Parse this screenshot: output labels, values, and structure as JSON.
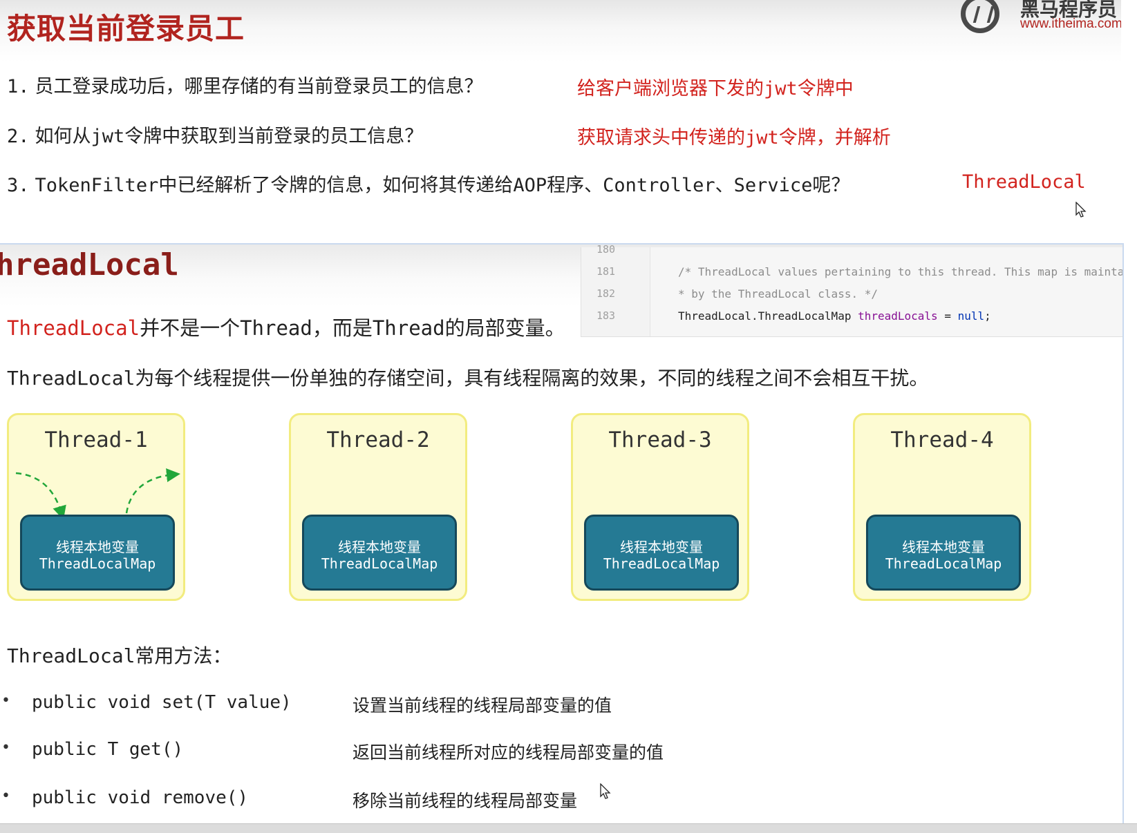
{
  "top": {
    "title": "获取当前登录员工",
    "logo": {
      "brand": "黑马程序员",
      "url": "www.itheima.com"
    },
    "questions": [
      {
        "num": "1.",
        "text": "员工登录成功后，哪里存储的有当前登录员工的信息？",
        "answer": "给客户端浏览器下发的jwt令牌中"
      },
      {
        "num": "2.",
        "text": "如何从jwt令牌中获取到当前登录的员工信息？",
        "answer": "获取请求头中传递的jwt令牌，并解析"
      },
      {
        "num": "3.",
        "text": "TokenFilter中已经解析了令牌的信息，如何将其传递给AOP程序、Controller、Service呢？",
        "answer": "ThreadLocal"
      }
    ]
  },
  "bottom": {
    "title": "hreadLocal",
    "code": {
      "lines": [
        {
          "num": "180",
          "text": ""
        },
        {
          "num": "181",
          "text": "/* ThreadLocal values pertaining to this thread. This map is maintai"
        },
        {
          "num": "182",
          "text": " * by the ThreadLocal class. */"
        },
        {
          "num": "183",
          "type_text": "ThreadLocal.ThreadLocalMap ",
          "var_text": "threadLocals",
          "eq_text": " = ",
          "kw_text": "null",
          "end_text": ";"
        }
      ]
    },
    "intro": {
      "red": "ThreadLocal",
      "rest": "并不是一个Thread，而是Thread的局部变量。"
    },
    "description": "ThreadLocal为每个线程提供一份单独的存储空间，具有线程隔离的效果，不同的线程之间不会相互干扰。",
    "threads": [
      {
        "name": "Thread-1",
        "map_cn": "线程本地变量",
        "map_en": "ThreadLocalMap"
      },
      {
        "name": "Thread-2",
        "map_cn": "线程本地变量",
        "map_en": "ThreadLocalMap"
      },
      {
        "name": "Thread-3",
        "map_cn": "线程本地变量",
        "map_en": "ThreadLocalMap"
      },
      {
        "name": "Thread-4",
        "map_cn": "线程本地变量",
        "map_en": "ThreadLocalMap"
      }
    ],
    "methods_title": "ThreadLocal常用方法：",
    "methods": [
      {
        "bullet": "•",
        "signature": "public void set(T value)",
        "desc": "设置当前线程的线程局部变量的值"
      },
      {
        "bullet": "•",
        "signature": "public T get()",
        "desc": "返回当前线程所对应的线程局部变量的值"
      },
      {
        "bullet": "•",
        "signature": "public void remove()",
        "desc": "移除当前线程的线程局部变量"
      }
    ]
  },
  "colors": {
    "title_red": "#b1241f",
    "answer_red": "#d2231e",
    "thread_bg": "#fdfbd3",
    "thread_border": "#f2ec7f",
    "map_fill": "#257a94",
    "arrow_green": "#22a63a"
  },
  "icons": {
    "logo": "itheima-logo-icon",
    "cursor": "mouse-pointer-icon",
    "arrow": "dashed-arrow-icon"
  }
}
